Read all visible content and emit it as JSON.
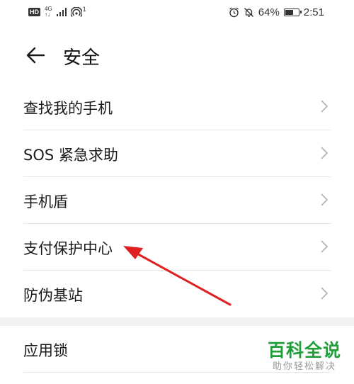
{
  "status_bar": {
    "hd": "HD",
    "network_top": "4G",
    "network_bottom": "↑↓",
    "wifi_badge": "1",
    "battery_percent": "64%",
    "battery_level": 0.64,
    "time": "2:51"
  },
  "header": {
    "title": "安全"
  },
  "list": {
    "items": [
      {
        "label": "查找我的手机"
      },
      {
        "label": "SOS 紧急求助"
      },
      {
        "label": "手机盾"
      },
      {
        "label": "支付保护中心"
      },
      {
        "label": "防伪基站"
      }
    ]
  },
  "list2": {
    "items": [
      {
        "label": "应用锁"
      }
    ]
  },
  "watermark": {
    "main": "百科全说",
    "sub": "助你轻松解决"
  },
  "colors": {
    "arrow": "#e02020",
    "watermark": "#1f9e3a",
    "chevron": "#b5b5b5"
  }
}
